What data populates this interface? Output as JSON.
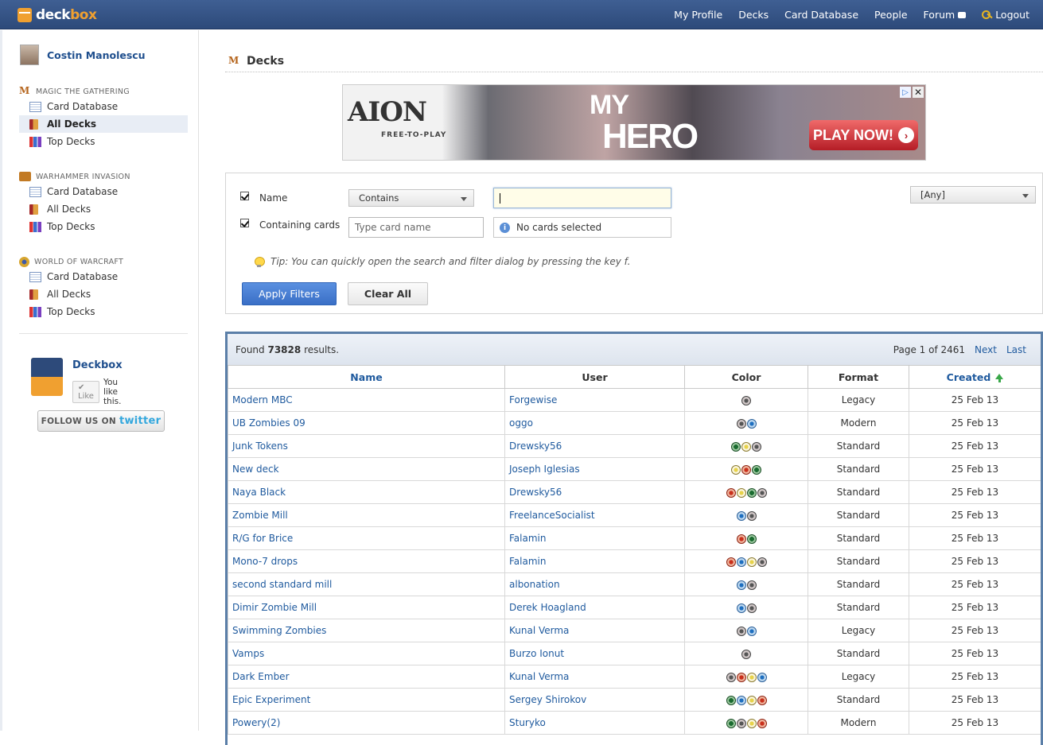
{
  "topbar": {
    "logo_prefix": "deck",
    "logo_suffix": "box",
    "nav": [
      "My Profile",
      "Decks",
      "Card Database",
      "People",
      "Forum",
      "Logout"
    ]
  },
  "sidebar": {
    "user_name": "Costin Manolescu",
    "sections": [
      {
        "title": "MAGIC THE GATHERING",
        "items": [
          "Card Database",
          "All Decks",
          "Top Decks"
        ]
      },
      {
        "title": "WARHAMMER INVASION",
        "items": [
          "Card Database",
          "All Decks",
          "Top Decks"
        ]
      },
      {
        "title": "WORLD OF WARCRAFT",
        "items": [
          "Card Database",
          "All Decks",
          "Top Decks"
        ]
      }
    ],
    "fb_title": "Deckbox",
    "fb_like": "Like",
    "fb_like_text": "You like this.",
    "twitter_prefix": "FOLLOW US ON",
    "twitter_brand": "twitter"
  },
  "main": {
    "title": "Decks",
    "ad": {
      "logo": "AION",
      "sub": "FREE-TO-PLAY",
      "headline1": "MY",
      "headline2": "HERO",
      "cta": "PLAY NOW!"
    },
    "filters": {
      "name_label": "Name",
      "name_op": "Contains",
      "name_value": "",
      "containing_label": "Containing cards",
      "card_placeholder": "Type card name",
      "no_cards": "No cards selected",
      "format_select": "[Any]",
      "tip": "Tip: You can quickly open the search and filter dialog by pressing the key f.",
      "apply": "Apply Filters",
      "clear": "Clear All"
    },
    "results": {
      "found_prefix": "Found",
      "found_count": "73828",
      "found_suffix": "results.",
      "page_info": "Page 1 of 2461",
      "next": "Next",
      "last": "Last",
      "columns": [
        "Name",
        "User",
        "Color",
        "Format",
        "Created"
      ],
      "rows": [
        {
          "name": "Modern MBC",
          "user": "Forgewise",
          "colors": [
            "B"
          ],
          "format": "Legacy",
          "created": "25 Feb 13"
        },
        {
          "name": "UB Zombies 09",
          "user": "oggo",
          "colors": [
            "B",
            "U"
          ],
          "format": "Modern",
          "created": "25 Feb 13"
        },
        {
          "name": "Junk Tokens",
          "user": "Drewsky56",
          "colors": [
            "G",
            "W",
            "B"
          ],
          "format": "Standard",
          "created": "25 Feb 13"
        },
        {
          "name": "New deck",
          "user": "Joseph Iglesias",
          "colors": [
            "W",
            "R",
            "G"
          ],
          "format": "Standard",
          "created": "25 Feb 13"
        },
        {
          "name": "Naya Black",
          "user": "Drewsky56",
          "colors": [
            "R",
            "W",
            "G",
            "B"
          ],
          "format": "Standard",
          "created": "25 Feb 13"
        },
        {
          "name": "Zombie Mill",
          "user": "FreelanceSocialist",
          "colors": [
            "U",
            "B"
          ],
          "format": "Standard",
          "created": "25 Feb 13"
        },
        {
          "name": "R/G for Brice",
          "user": "Falamin",
          "colors": [
            "R",
            "G"
          ],
          "format": "Standard",
          "created": "25 Feb 13"
        },
        {
          "name": "Mono-7 drops",
          "user": "Falamin",
          "colors": [
            "R",
            "U",
            "W",
            "B"
          ],
          "format": "Standard",
          "created": "25 Feb 13"
        },
        {
          "name": "second standard mill",
          "user": "albonation",
          "colors": [
            "U",
            "B"
          ],
          "format": "Standard",
          "created": "25 Feb 13"
        },
        {
          "name": "Dimir Zombie Mill",
          "user": "Derek Hoagland",
          "colors": [
            "U",
            "B"
          ],
          "format": "Standard",
          "created": "25 Feb 13"
        },
        {
          "name": "Swimming Zombies",
          "user": "Kunal Verma",
          "colors": [
            "B",
            "U"
          ],
          "format": "Legacy",
          "created": "25 Feb 13"
        },
        {
          "name": "Vamps",
          "user": "Burzo Ionut",
          "colors": [
            "B"
          ],
          "format": "Standard",
          "created": "25 Feb 13"
        },
        {
          "name": "Dark Ember",
          "user": "Kunal Verma",
          "colors": [
            "B",
            "R",
            "W",
            "U"
          ],
          "format": "Legacy",
          "created": "25 Feb 13"
        },
        {
          "name": "Epic Experiment",
          "user": "Sergey Shirokov",
          "colors": [
            "G",
            "U",
            "W",
            "R"
          ],
          "format": "Standard",
          "created": "25 Feb 13"
        },
        {
          "name": "Powery(2)",
          "user": "Sturyko",
          "colors": [
            "G",
            "B",
            "W",
            "R"
          ],
          "format": "Modern",
          "created": "25 Feb 13"
        }
      ]
    }
  }
}
